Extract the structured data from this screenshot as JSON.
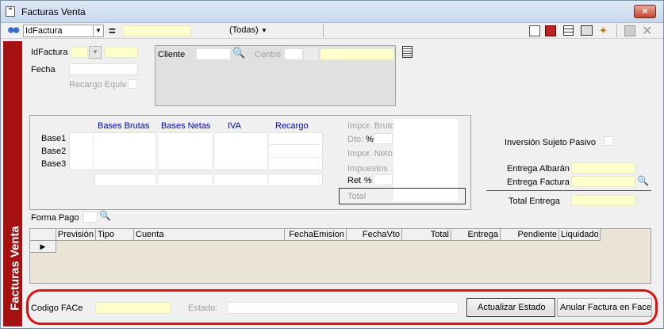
{
  "window": {
    "title": "Facturas Venta",
    "close": "×"
  },
  "toolbar": {
    "field_select": "IdFactura",
    "operator": "=",
    "filter_select": "(Todas)"
  },
  "sidebar": {
    "label": "Facturas Venta"
  },
  "header": {
    "idfactura_label": "IdFactura",
    "fecha_label": "Fecha",
    "recargo_label": "Recargo Equiv",
    "cliente_label": "Cliente",
    "centro_label": "Centro"
  },
  "totals": {
    "col_bases_brutas": "Bases Brutas",
    "col_bases_netas": "Bases Netas",
    "col_iva": "IVA",
    "col_recargo": "Recargo",
    "rows": [
      "Base1",
      "Base2",
      "Base3"
    ],
    "impor_bruto": "Impor. Bruto",
    "dto": "Dto:",
    "pct1": "%",
    "impor_neto": "Impor. Neto",
    "impuestos": "Impuestos",
    "ret": "Ret",
    "pct2": "%",
    "total": "Total"
  },
  "right": {
    "inversion": "Inversión Sujeto Pasivo",
    "entrega_albaran": "Entrega Albarán",
    "entrega_factura": "Entrega Factura",
    "total_entrega": "Total Entrega"
  },
  "payment": {
    "forma_pago": "Forma Pago"
  },
  "grid": {
    "columns": [
      "Previsión",
      "Tipo",
      "Cuenta",
      "FechaEmision",
      "FechaVto",
      "Total",
      "Entrega",
      "Pendiente",
      "Liquidado"
    ]
  },
  "face": {
    "codigo_label": "Codigo FACe",
    "estado_label": "Estado:",
    "actualizar": "Actualizar Estado",
    "anular": "Anular Factura en Face"
  }
}
